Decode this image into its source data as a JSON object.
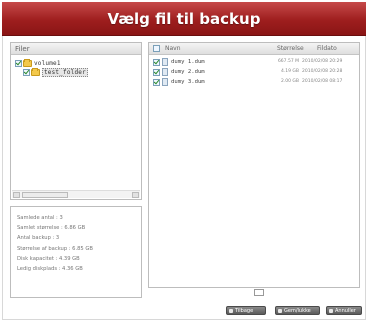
{
  "window": {
    "title": "Vælg fil til backup"
  },
  "tree_panel": {
    "header": "Filer",
    "nodes": [
      {
        "label": "volume1",
        "checked": true,
        "selected": false
      },
      {
        "label": "test_folder",
        "checked": true,
        "selected": true
      }
    ]
  },
  "files_panel": {
    "columns": {
      "name": "Navn",
      "size": "Størrelse",
      "date": "Fildato"
    },
    "rows": [
      {
        "name": "dumy 1.dum",
        "size": "667.57 M",
        "date": "2010/02/08 20:29",
        "checked": true
      },
      {
        "name": "dumy 2.dum",
        "size": "4.19 GB",
        "date": "2010/02/08 20:28",
        "checked": true
      },
      {
        "name": "dumy 3.dum",
        "size": "2.00 GB",
        "date": "2010/02/08 08:17",
        "checked": true
      }
    ]
  },
  "stats": [
    "Samlede antal : 3",
    "Samlet størrelse : 6.86 GB",
    "Antal backup : 3",
    "Størrelse af backup : 6.85 GB",
    "Disk kapacitet : 4.39 GB",
    "Ledig diskplads : 4.36 GB"
  ],
  "buttons": {
    "back": "Tilbage",
    "save": "Gem/lukke",
    "cancel": "Annuller"
  },
  "colors": {
    "title_bar": "#9e1e1e",
    "button": "#6a6a6a"
  }
}
